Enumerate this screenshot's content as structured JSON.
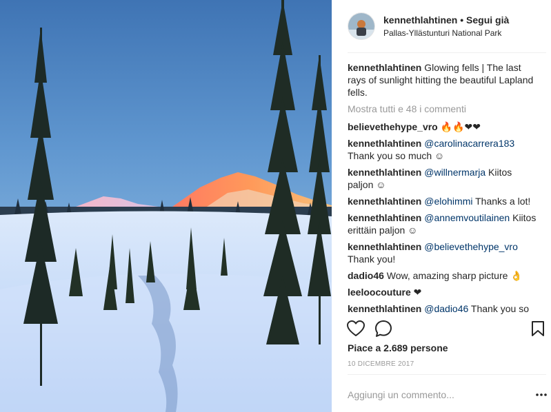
{
  "post": {
    "username": "kennethlahtinen",
    "follow_separator": " • ",
    "follow_status": "Segui già",
    "location": "Pallas-Yllästunturi National Park",
    "caption": {
      "user": "kennethlahtinen",
      "text": " Glowing fells | The last rays of sunlight hitting the beautiful Lapland fells."
    },
    "view_all": "Mostra tutti e 48 i commenti",
    "comments": [
      {
        "user": "believethehype_vro",
        "mention": "",
        "text": " 🔥🔥❤❤"
      },
      {
        "user": "kennethlahtinen",
        "mention": " @carolinacarrera183",
        "text": " Thank you so much ☺"
      },
      {
        "user": "kennethlahtinen",
        "mention": " @willnermarja",
        "text": " Kiitos paljon ☺"
      },
      {
        "user": "kennethlahtinen",
        "mention": " @elohimmi",
        "text": " Thanks a lot!"
      },
      {
        "user": "kennethlahtinen",
        "mention": " @annemvoutilainen",
        "text": " Kiitos erittäin paljon ☺"
      },
      {
        "user": "kennethlahtinen",
        "mention": " @believethehype_vro",
        "text": " Thank you!"
      },
      {
        "user": "dadio46",
        "mention": "",
        "text": " Wow, amazing sharp picture 👌"
      },
      {
        "user": "leeloocouture",
        "mention": "",
        "text": " ❤"
      },
      {
        "user": "kennethlahtinen",
        "mention": " @dadio46",
        "text": " Thank you so much"
      }
    ],
    "likes": "Piace a 2.689 persone",
    "date": "10 DICEMBRE 2017",
    "comment_placeholder": "Aggiungi un commento..."
  },
  "icons": {
    "like": "heart-icon",
    "comment": "speech-bubble-icon",
    "save": "bookmark-icon",
    "more": "ellipsis-icon"
  },
  "colors": {
    "text": "#262626",
    "secondary": "#999999",
    "mention": "#003569",
    "divider": "#efefef"
  }
}
